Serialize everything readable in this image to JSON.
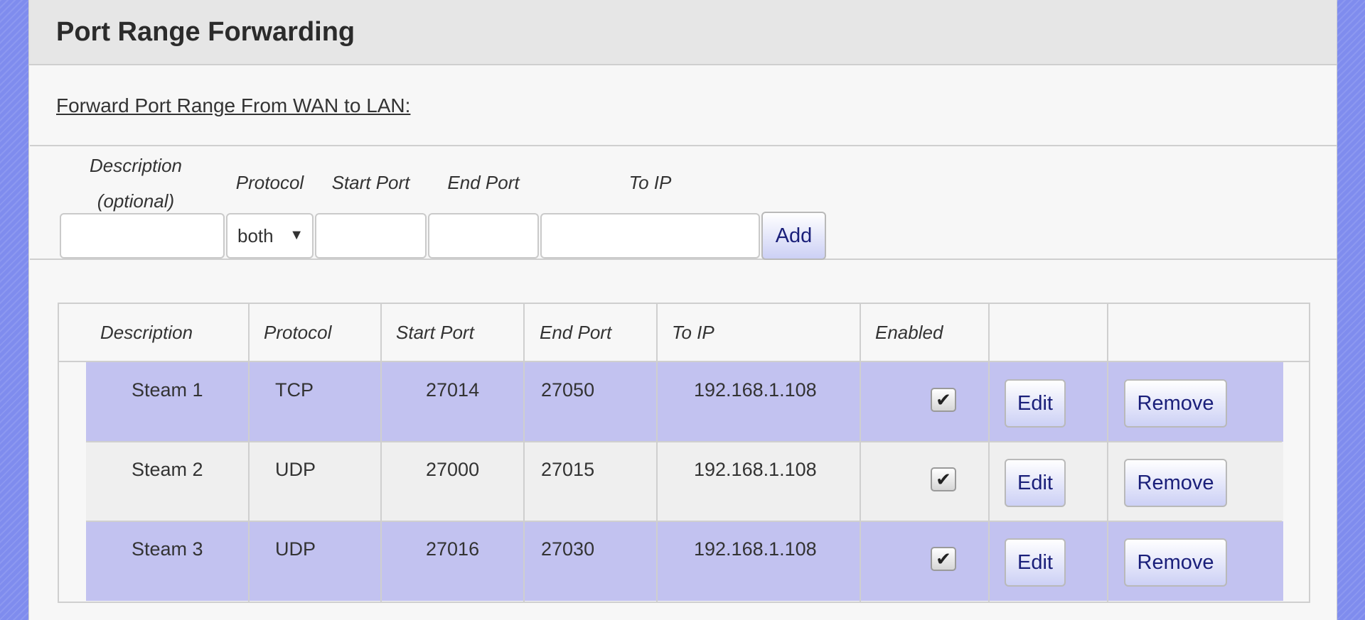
{
  "header": {
    "title": "Port Range Forwarding"
  },
  "section": {
    "label": "Forward Port Range From WAN to LAN:"
  },
  "form": {
    "labels": {
      "description": "Description",
      "description_note": "(optional)",
      "protocol": "Protocol",
      "start_port": "Start Port",
      "end_port": "End Port",
      "to_ip": "To IP"
    },
    "protocol_selected": "both",
    "description_value": "",
    "start_port_value": "",
    "end_port_value": "",
    "to_ip_value": "",
    "add_label": "Add"
  },
  "table": {
    "headers": {
      "description": "Description",
      "protocol": "Protocol",
      "start_port": "Start Port",
      "end_port": "End Port",
      "to_ip": "To IP",
      "enabled": "Enabled"
    },
    "edit_label": "Edit",
    "remove_label": "Remove",
    "rows": [
      {
        "description": "Steam 1",
        "protocol": "TCP",
        "start_port": "27014",
        "end_port": "27050",
        "to_ip": "192.168.1.108",
        "enabled": true
      },
      {
        "description": "Steam 2",
        "protocol": "UDP",
        "start_port": "27000",
        "end_port": "27015",
        "to_ip": "192.168.1.108",
        "enabled": true
      },
      {
        "description": "Steam 3",
        "protocol": "UDP",
        "start_port": "27016",
        "end_port": "27030",
        "to_ip": "192.168.1.108",
        "enabled": true
      }
    ]
  },
  "colors": {
    "background": "#7f8cee",
    "row_highlight": "#c2c2f0",
    "button_text": "#1a1f7a"
  },
  "icons": {
    "checkbox": "checkmark-icon",
    "select": "chevron-down-icon"
  }
}
